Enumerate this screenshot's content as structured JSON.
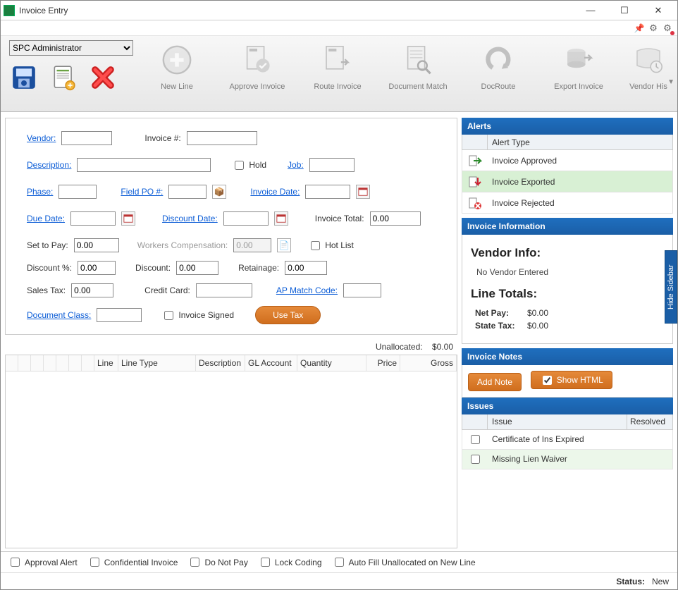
{
  "window": {
    "title": "Invoice Entry"
  },
  "pinbar": {},
  "ribbon": {
    "user_select": "SPC Administrator",
    "tools": {
      "new_line": "New Line",
      "approve": "Approve Invoice",
      "route": "Route Invoice",
      "docmatch": "Document Match",
      "docroute": "DocRoute",
      "export": "Export Invoice",
      "vendorhist": "Vendor His"
    }
  },
  "form": {
    "vendor_label": "Vendor:",
    "vendor": "",
    "invoice_num_label": "Invoice #:",
    "invoice_num": "",
    "description_label": "Description:",
    "description": "",
    "hold_label": "Hold",
    "job_label": "Job:",
    "job": "",
    "phase_label": "Phase:",
    "phase": "",
    "field_po_label": "Field PO #:",
    "field_po": "",
    "invoice_date_label": "Invoice Date:",
    "invoice_date": "",
    "due_date_label": "Due Date:",
    "due_date": "",
    "discount_date_label": "Discount Date:",
    "discount_date": "",
    "invoice_total_label": "Invoice Total:",
    "invoice_total": "0.00",
    "set_to_pay_label": "Set to Pay:",
    "set_to_pay": "0.00",
    "workers_comp_label": "Workers Compensation:",
    "workers_comp": "0.00",
    "hot_list_label": "Hot List",
    "discount_pct_label": "Discount %:",
    "discount_pct": "0.00",
    "discount_label": "Discount:",
    "discount": "0.00",
    "retainage_label": "Retainage:",
    "retainage": "0.00",
    "sales_tax_label": "Sales Tax:",
    "sales_tax": "0.00",
    "credit_card_label": "Credit Card:",
    "credit_card": "",
    "ap_match_label": "AP Match Code:",
    "ap_match": "",
    "doc_class_label": "Document Class:",
    "doc_class": "",
    "invoice_signed_label": "Invoice Signed",
    "use_tax_btn": "Use Tax"
  },
  "unallocated": {
    "label": "Unallocated:",
    "value": "$0.00"
  },
  "grid": {
    "cols": {
      "line": "Line",
      "linetype": "Line Type",
      "description": "Description",
      "glaccount": "GL Account",
      "quantity": "Quantity",
      "price": "Price",
      "gross": "Gross"
    }
  },
  "alerts": {
    "header": "Alerts",
    "col": "Alert Type",
    "rows": [
      {
        "label": "Invoice Approved",
        "kind": "approved"
      },
      {
        "label": "Invoice Exported",
        "kind": "exported",
        "selected": true
      },
      {
        "label": "Invoice Rejected",
        "kind": "rejected"
      }
    ]
  },
  "info": {
    "header": "Invoice Information",
    "vendor_info_title": "Vendor Info:",
    "vendor_info_text": "No Vendor Entered",
    "line_totals_title": "Line Totals:",
    "net_pay_label": "Net Pay:",
    "net_pay": "$0.00",
    "state_tax_label": "State Tax:",
    "state_tax": "$0.00"
  },
  "notes": {
    "header": "Invoice Notes",
    "add_note": "Add Note",
    "show_html": "Show HTML"
  },
  "issues": {
    "header": "Issues",
    "col_issue": "Issue",
    "col_resolved": "Resolved",
    "rows": [
      {
        "label": "Certificate of Ins Expired"
      },
      {
        "label": "Missing Lien Waiver",
        "selected": true
      }
    ]
  },
  "sidebar_toggle": "Hide Sidebar",
  "footer": {
    "approval_alert": "Approval Alert",
    "confidential": "Confidential Invoice",
    "do_not_pay": "Do Not Pay",
    "lock_coding": "Lock Coding",
    "auto_fill": "Auto Fill Unallocated on New Line"
  },
  "status": {
    "label": "Status:",
    "value": "New"
  }
}
